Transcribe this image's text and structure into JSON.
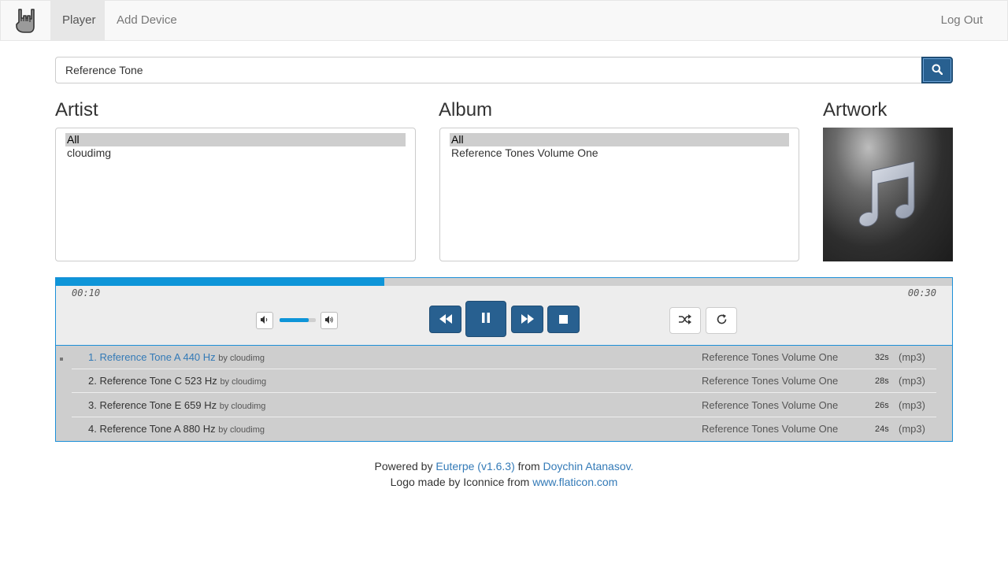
{
  "navbar": {
    "logo_icon": "rock-hand-icon",
    "items": [
      {
        "label": "Player",
        "active": true
      },
      {
        "label": "Add Device",
        "active": false
      }
    ],
    "logout_label": "Log Out"
  },
  "search": {
    "value": "Reference Tone",
    "button_icon": "search-icon"
  },
  "artist": {
    "title": "Artist",
    "options": [
      "All",
      "cloudimg"
    ],
    "selected": "All"
  },
  "album": {
    "title": "Album",
    "options": [
      "All",
      "Reference Tones Volume One"
    ],
    "selected": "All"
  },
  "artwork": {
    "title": "Artwork",
    "icon": "music-note-icon"
  },
  "player": {
    "elapsed": "00:10",
    "total": "00:30",
    "progress_fraction": 0.3667,
    "volume_fraction": 0.8,
    "accent_color": "#0e95d8",
    "button_color": "#286090",
    "controls": [
      "rewind-icon",
      "pause-icon",
      "fast-forward-icon",
      "stop-icon"
    ],
    "options": [
      "shuffle-icon",
      "repeat-icon"
    ]
  },
  "playlist": {
    "tracks": [
      {
        "title": "1. Reference Tone A 440 Hz",
        "by": "by cloudimg",
        "album": "Reference Tones Volume One",
        "duration": "32s",
        "format": "(mp3)",
        "current": true
      },
      {
        "title": "2. Reference Tone C 523 Hz",
        "by": "by cloudimg",
        "album": "Reference Tones Volume One",
        "duration": "28s",
        "format": "(mp3)",
        "current": false
      },
      {
        "title": "3. Reference Tone E 659 Hz",
        "by": "by cloudimg",
        "album": "Reference Tones Volume One",
        "duration": "26s",
        "format": "(mp3)",
        "current": false
      },
      {
        "title": "4. Reference Tone A 880 Hz",
        "by": "by cloudimg",
        "album": "Reference Tones Volume One",
        "duration": "24s",
        "format": "(mp3)",
        "current": false
      }
    ]
  },
  "footer": {
    "powered_prefix": "Powered by",
    "app_link": "Euterpe (v1.6.3)",
    "from_text": "from",
    "author_link": "Doychin Atanasov.",
    "logo_prefix": "Logo made by Iconnice from",
    "logo_link": "www.flaticon.com"
  }
}
